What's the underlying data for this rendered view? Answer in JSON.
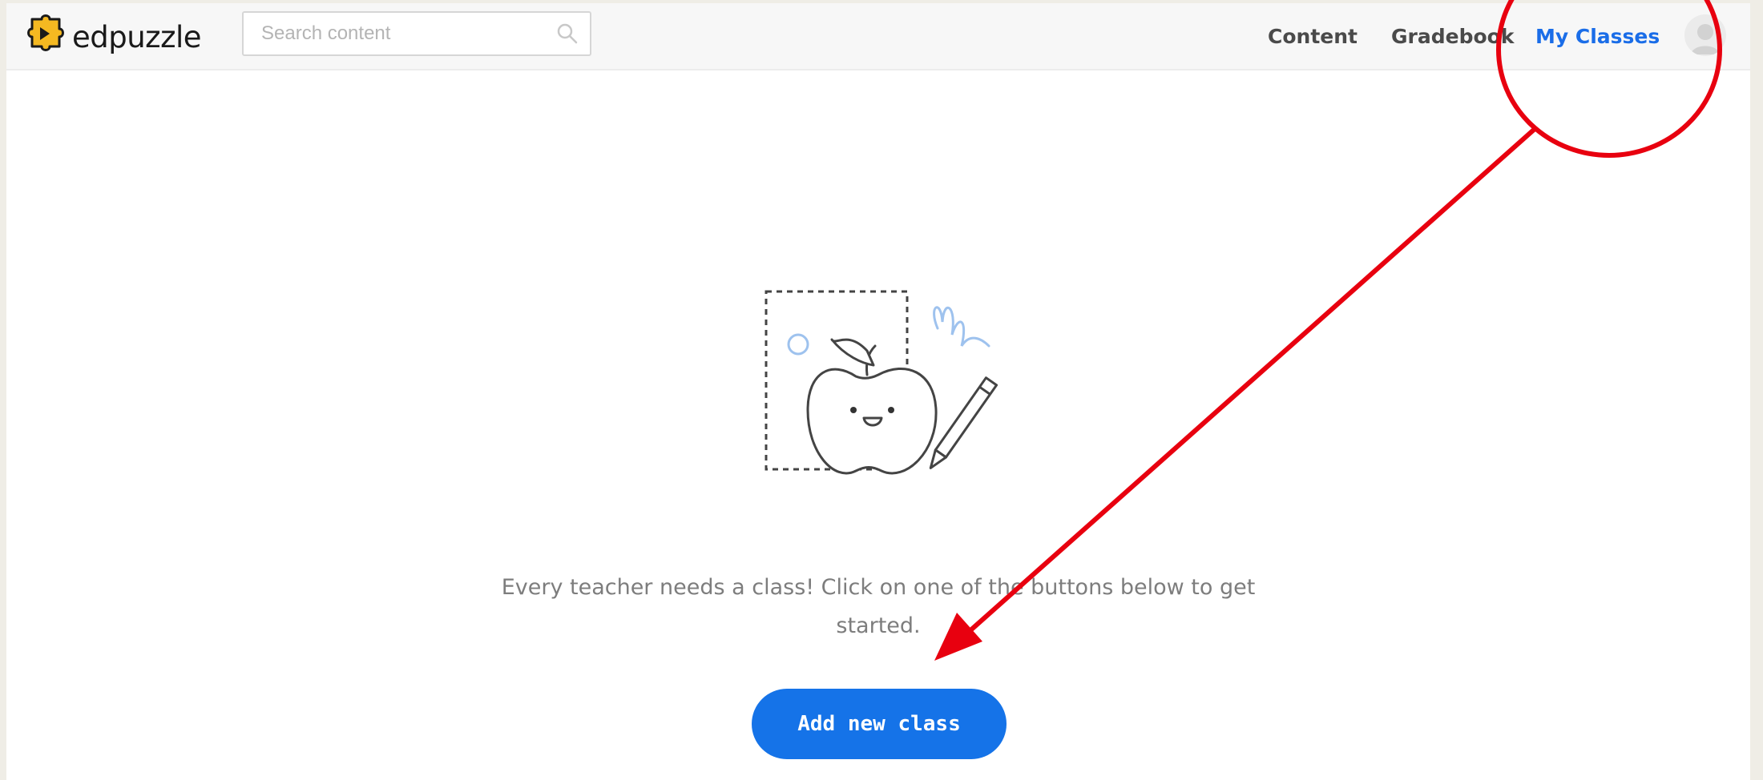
{
  "header": {
    "logo_text": "edpuzzle",
    "search": {
      "placeholder": "Search content"
    },
    "nav": [
      {
        "label": "Content",
        "active": false
      },
      {
        "label": "Gradebook",
        "active": false
      },
      {
        "label": "My Classes",
        "active": true
      }
    ]
  },
  "empty_state": {
    "message": "Every teacher needs a class! Click on one of the buttons below to get started.",
    "button_label": "Add new class"
  },
  "icons": {
    "logo": "edpuzzle-puzzle-logo-icon",
    "search": "magnifier-icon",
    "avatar": "user-avatar-icon"
  },
  "colors": {
    "accent_blue": "#1573e8",
    "nav_active": "#1a6de8",
    "annotation_red": "#e8000f",
    "logo_yellow": "#f5b921"
  }
}
